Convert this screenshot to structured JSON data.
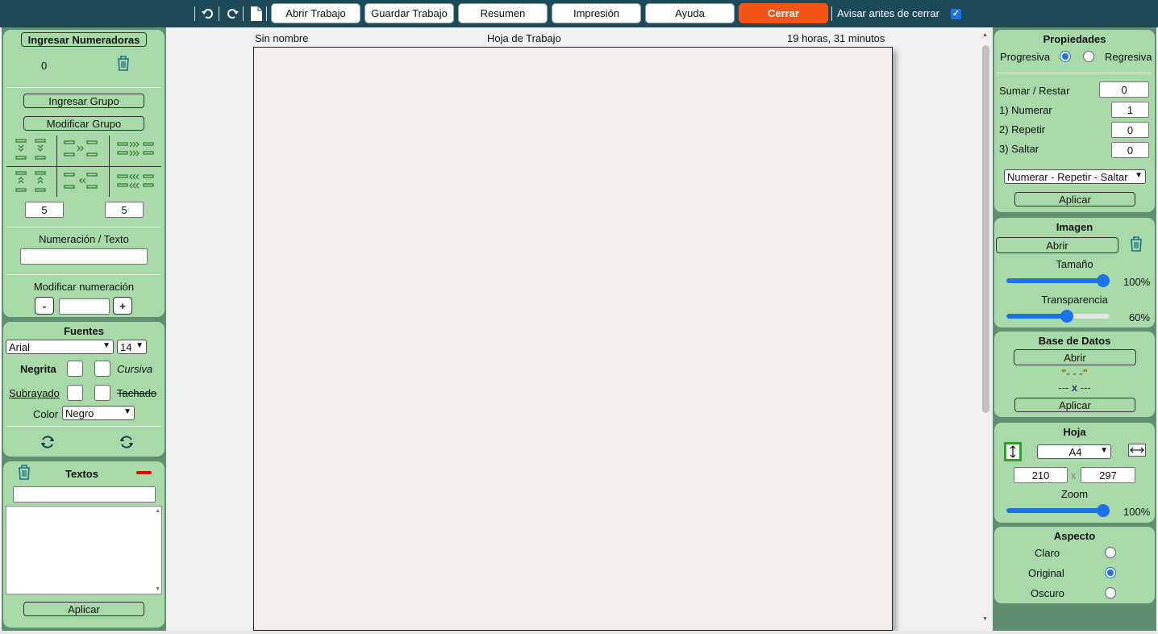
{
  "topbar": {
    "buttons": {
      "open": "Abrir Trabajo",
      "save": "Guardar Trabajo",
      "summary": "Resumen",
      "print": "Impresión",
      "help": "Ayuda",
      "close": "Cerrar"
    },
    "warn_label": "Avisar antes de cerrar",
    "warn_checked": true
  },
  "left": {
    "enter_numerators": "Ingresar Numeradoras",
    "count": "0",
    "enter_group": "Ingresar Grupo",
    "modify_group": "Modificar Grupo",
    "spacing_a": "5",
    "spacing_b": "5",
    "numbering_text_label": "Numeración / Texto",
    "modify_numbering_label": "Modificar numeración",
    "minus": "-",
    "plus": "+",
    "fonts_title": "Fuentes",
    "font_family": "Arial",
    "font_size": "14",
    "bold": "Negrita",
    "italic": "Cursiva",
    "underline": "Subrayado",
    "strike": "Tachado",
    "color_label": "Color",
    "color_value": "Negro",
    "texts_title": "Textos",
    "apply": "Aplicar"
  },
  "sheet": {
    "name": "Sin nombre",
    "title": "Hoja de Trabajo",
    "elapsed": "19 horas, 31 minutos"
  },
  "right": {
    "properties_title": "Propiedades",
    "progressive": "Progresiva",
    "regressive": "Regresiva",
    "progressive_selected": true,
    "add_sub_label": "Sumar / Restar",
    "add_sub_value": "0",
    "numerar_label": "1) Numerar",
    "numerar_value": "1",
    "repetir_label": "2) Repetir",
    "repetir_value": "0",
    "saltar_label": "3) Saltar",
    "saltar_value": "0",
    "order_select": "Numerar - Repetir - Saltar",
    "apply": "Aplicar",
    "image_title": "Imagen",
    "open": "Abrir",
    "size_label": "Tamaño",
    "size_value": "100%",
    "size_level": 1.0,
    "transparency_label": "Transparencia",
    "transparency_value": "60%",
    "transparency_level": 0.6,
    "db_title": "Base de Datos",
    "db_open": "Abrir",
    "db_quote": "\"- - -\"",
    "db_x_left": "---",
    "db_x": "x",
    "db_x_right": "---",
    "db_apply": "Aplicar",
    "sheet_title": "Hoja",
    "paper_size": "A4",
    "width_mm": "210",
    "height_mm": "297",
    "times": "x",
    "zoom_label": "Zoom",
    "zoom_value": "100%",
    "zoom_level": 1.0,
    "aspect_title": "Aspecto",
    "aspect_options": [
      "Claro",
      "Original",
      "Oscuro"
    ],
    "aspect_selected": "Original"
  },
  "colors": {
    "topbar": "#1d4a58",
    "panel": "#a8d9a8",
    "panel_bg": "#5e8f6e",
    "close_button": "#f55418",
    "accent": "#1a73e8",
    "sheet": "#f3efea"
  }
}
